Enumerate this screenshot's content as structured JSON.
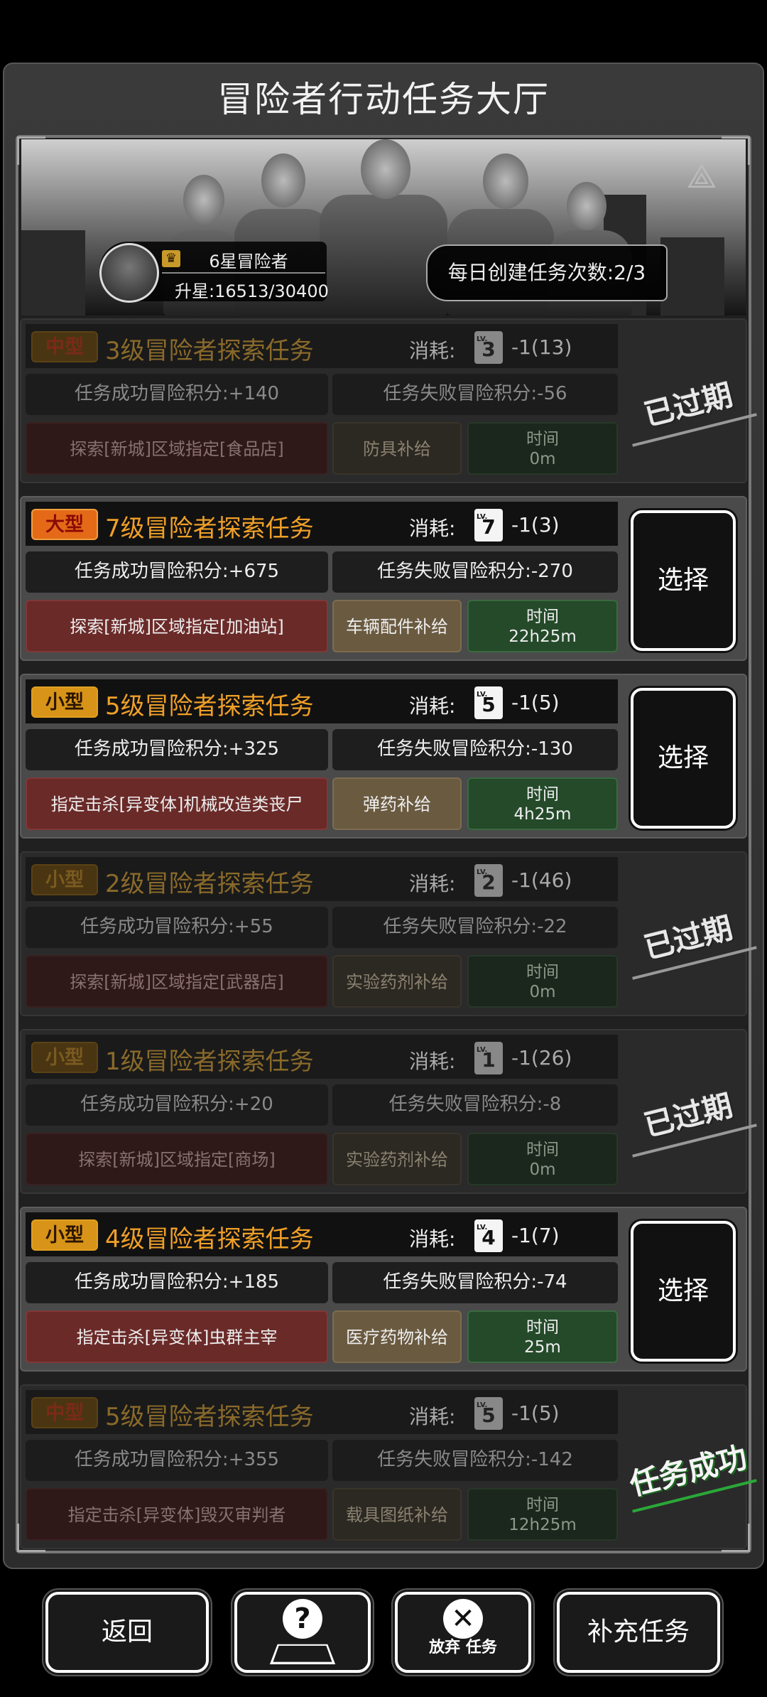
{
  "title": "冒险者行动任务大厅",
  "rank": {
    "name": "6星冒险者",
    "progress": "升星:16513/30400"
  },
  "daily": "每日创建任务次数:2/3",
  "labels": {
    "cost": "消耗:",
    "select": "选择",
    "lv": "LV."
  },
  "tasks": [
    {
      "size": "中型",
      "name": "3级冒险者探索任务",
      "lv": "3",
      "cost": "-1(13)",
      "success": "任务成功冒险积分:+140",
      "fail": "任务失败冒险积分:-56",
      "objective": "探索[新城]区域指定[食品店]",
      "supply": "防具补给",
      "time_label": "时间",
      "time": "0m",
      "status": "已过期"
    },
    {
      "size": "大型",
      "name": "7级冒险者探索任务",
      "lv": "7",
      "cost": "-1(3)",
      "success": "任务成功冒险积分:+675",
      "fail": "任务失败冒险积分:-270",
      "objective": "探索[新城]区域指定[加油站]",
      "supply": "车辆配件补给",
      "time_label": "时间",
      "time": "22h25m",
      "status": "选择"
    },
    {
      "size": "小型",
      "name": "5级冒险者探索任务",
      "lv": "5",
      "cost": "-1(5)",
      "success": "任务成功冒险积分:+325",
      "fail": "任务失败冒险积分:-130",
      "objective": "指定击杀[异变体]机械改造类丧尸",
      "supply": "弹药补给",
      "time_label": "时间",
      "time": "4h25m",
      "status": "选择"
    },
    {
      "size": "小型",
      "name": "2级冒险者探索任务",
      "lv": "2",
      "cost": "-1(46)",
      "success": "任务成功冒险积分:+55",
      "fail": "任务失败冒险积分:-22",
      "objective": "探索[新城]区域指定[武器店]",
      "supply": "实验药剂补给",
      "time_label": "时间",
      "time": "0m",
      "status": "已过期"
    },
    {
      "size": "小型",
      "name": "1级冒险者探索任务",
      "lv": "1",
      "cost": "-1(26)",
      "success": "任务成功冒险积分:+20",
      "fail": "任务失败冒险积分:-8",
      "objective": "探索[新城]区域指定[商场]",
      "supply": "实验药剂补给",
      "time_label": "时间",
      "time": "0m",
      "status": "已过期"
    },
    {
      "size": "小型",
      "name": "4级冒险者探索任务",
      "lv": "4",
      "cost": "-1(7)",
      "success": "任务成功冒险积分:+185",
      "fail": "任务失败冒险积分:-74",
      "objective": "指定击杀[异变体]虫群主宰",
      "supply": "医疗药物补给",
      "time_label": "时间",
      "time": "25m",
      "status": "选择"
    },
    {
      "size": "中型",
      "name": "5级冒险者探索任务",
      "lv": "5",
      "cost": "-1(5)",
      "success": "任务成功冒险积分:+355",
      "fail": "任务失败冒险积分:-142",
      "objective": "指定击杀[异变体]毁灭审判者",
      "supply": "载具图纸补给",
      "time_label": "时间",
      "time": "12h25m",
      "status": "任务成功"
    }
  ],
  "bottom": {
    "back": "返回",
    "abandon_a": "放弃",
    "abandon_b": "任务",
    "refill": "补充任务"
  },
  "icons": {
    "help": "question-map-icon",
    "abandon": "close-circle-icon",
    "crown": "crown-icon",
    "emblem": "triangle-emblem-icon"
  }
}
